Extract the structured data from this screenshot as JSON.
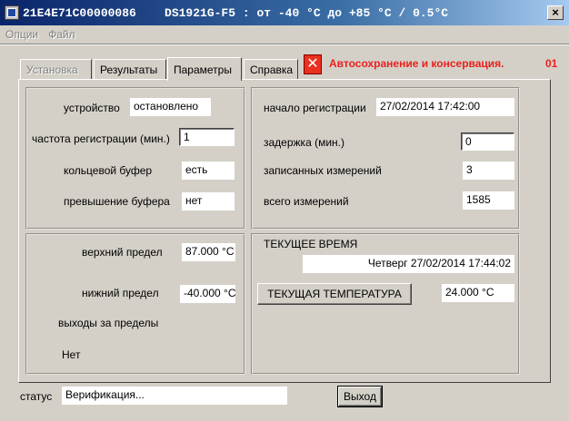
{
  "window": {
    "title": "21E4E71C00000086    DS1921G-F5 : от -40 °C до +85 °C / 0.5°C",
    "close_glyph": "×"
  },
  "menu": {
    "items": [
      "Опции",
      "Файл"
    ]
  },
  "tabs": [
    {
      "label": "Установка",
      "state": "disabled"
    },
    {
      "label": "Результаты",
      "state": "normal"
    },
    {
      "label": "Параметры",
      "state": "active"
    },
    {
      "label": "Справка",
      "state": "normal"
    }
  ],
  "autosave": {
    "icon": "x-icon",
    "icon_glyph": "✕",
    "text": "Автосохранение и консервация.",
    "number": "01",
    "color": "#e8211e"
  },
  "device_group": {
    "device_label": "устройство",
    "device_value": "остановлено",
    "freq_label": "частота регистрации (мин.)",
    "freq_value": "1",
    "ring_label": "кольцевой буфер",
    "ring_value": "есть",
    "overflow_label": "превышение буфера",
    "overflow_value": "нет"
  },
  "registration_group": {
    "start_label": "начало регистрации",
    "start_value": "27/02/2014 17:42:00",
    "delay_label": "задержка (мин.)",
    "delay_value": "0",
    "recorded_label": "записанных измерений",
    "recorded_value": "3",
    "total_label": "всего измерений",
    "total_value": "1585"
  },
  "limits_group": {
    "upper_label": "верхний предел",
    "upper_value": "87.000 °C",
    "lower_label": "нижний предел",
    "lower_value": "-40.000 °C",
    "out_label": "выходы за пределы",
    "out_value": "Нет"
  },
  "time_group": {
    "current_time_label": "ТЕКУЩЕЕ ВРЕМЯ",
    "current_time_value": "Четверг 27/02/2014 17:44:02",
    "temp_button": "ТЕКУЩАЯ ТЕМПЕРАТУРА",
    "temp_value": "24.000 °C"
  },
  "status": {
    "label": "статус",
    "value": "Верификация..."
  },
  "exit_button": "Выход"
}
